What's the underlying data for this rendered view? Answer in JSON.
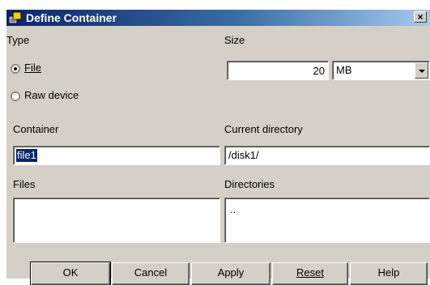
{
  "window": {
    "title": "Define Container",
    "close_glyph": "×"
  },
  "type_section": {
    "label": "Type",
    "options": [
      {
        "label": "File",
        "selected": true
      },
      {
        "label": "Raw device",
        "selected": false
      }
    ]
  },
  "size_section": {
    "label": "Size",
    "value": "20",
    "unit": "MB"
  },
  "container": {
    "label": "Container",
    "value": "file1"
  },
  "current_directory": {
    "label": "Current directory",
    "value": "/disk1/"
  },
  "files": {
    "label": "Files",
    "items": []
  },
  "directories": {
    "label": "Directories",
    "items": [
      ".."
    ]
  },
  "buttons": {
    "ok": "OK",
    "cancel": "Cancel",
    "apply": "Apply",
    "reset": "Reset",
    "help": "Help"
  }
}
